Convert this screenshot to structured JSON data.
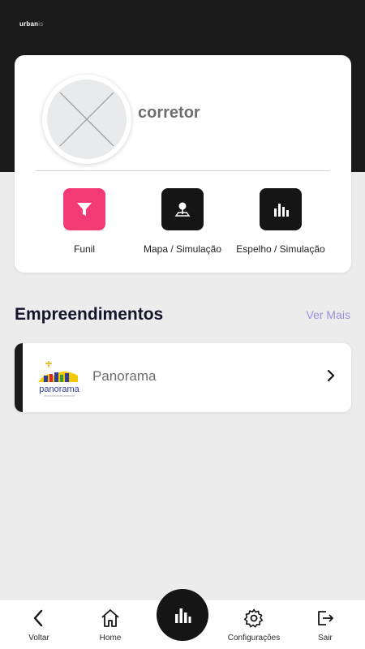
{
  "header": {
    "brand_main": "urban",
    "brand_suffix": "is"
  },
  "profile": {
    "username": "corretor"
  },
  "actions": [
    {
      "label": "Funil",
      "icon": "funnel-icon",
      "color": "#f23a74"
    },
    {
      "label": "Mapa / Simulação",
      "icon": "map-pin-icon",
      "color": "#151515"
    },
    {
      "label": "Espelho / Simulação",
      "icon": "bar-chart-icon",
      "color": "#151515"
    }
  ],
  "developments": {
    "title": "Empreendimentos",
    "see_more": "Ver Mais",
    "items": [
      {
        "name": "Panorama",
        "logo_text": "panorama"
      }
    ]
  },
  "bottom_nav": {
    "back": "Voltar",
    "home": "Home",
    "settings": "Configurações",
    "logout": "Sair"
  },
  "colors": {
    "dark": "#1b1b1b",
    "accent_pink": "#f23a74",
    "link_purple": "#9b8fd9",
    "background": "#ececec"
  }
}
